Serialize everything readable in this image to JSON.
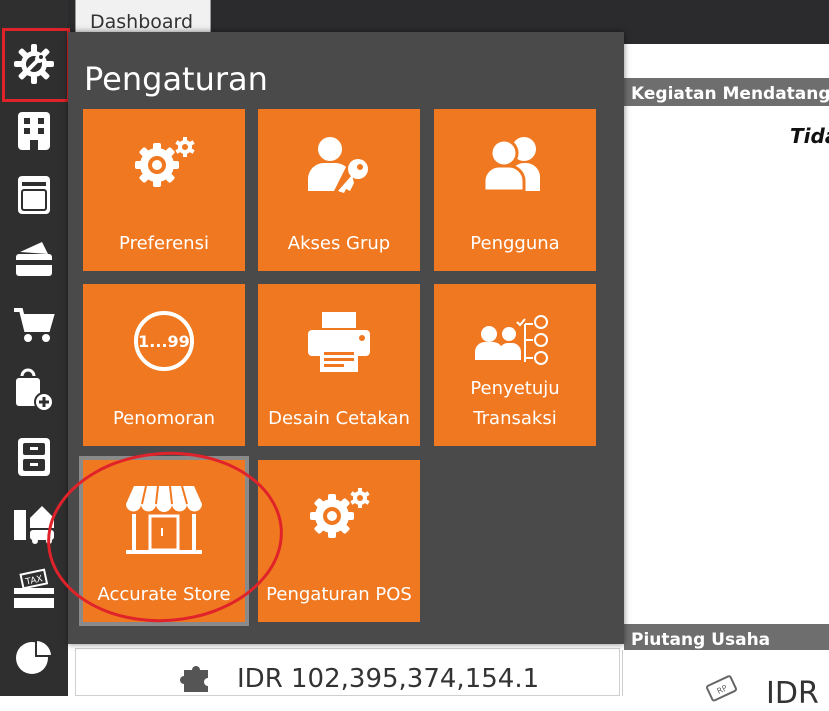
{
  "tab": {
    "label": "Dashboard"
  },
  "sidebar": {
    "items": [
      {
        "icon": "settings-icon"
      },
      {
        "icon": "building-icon"
      },
      {
        "icon": "ledger-book-icon"
      },
      {
        "icon": "wallet-cards-icon"
      },
      {
        "icon": "shopping-cart-icon"
      },
      {
        "icon": "shopping-bag-add-icon"
      },
      {
        "icon": "cabinet-icon"
      },
      {
        "icon": "company-assets-icon"
      },
      {
        "icon": "tax-icon"
      },
      {
        "icon": "pie-chart-icon"
      }
    ]
  },
  "popup": {
    "title": "Pengaturan",
    "tiles": [
      {
        "label": "Preferensi",
        "icon": "gears-icon"
      },
      {
        "label": "Akses Grup",
        "icon": "user-key-icon"
      },
      {
        "label": "Pengguna",
        "icon": "users-icon"
      },
      {
        "label": "Penomoran",
        "icon": "numbering-icon",
        "icon_text": "1...99"
      },
      {
        "label": "Desain Cetakan",
        "icon": "printer-icon"
      },
      {
        "label": "Penyetuju\nTransaksi",
        "label_line1": "Penyetuju",
        "label_line2": "Transaksi",
        "icon": "approval-flow-icon"
      },
      {
        "label": "Accurate Store",
        "icon": "store-icon"
      },
      {
        "label": "Pengaturan POS",
        "icon": "pos-gears-icon"
      }
    ]
  },
  "dashboard": {
    "upcoming_header": "Kegiatan Mendatang",
    "upcoming_text": "Tida",
    "receivables_header": "Piutang Usaha",
    "amount": "IDR 102,395,374,154.1",
    "amount_right": "IDR",
    "rp_badge": "RP"
  },
  "colors": {
    "tile": "#f07820",
    "popup_bg": "#4a4a4a",
    "sidebar_bg": "#2f2f2f",
    "annotation": "#e0232a"
  }
}
